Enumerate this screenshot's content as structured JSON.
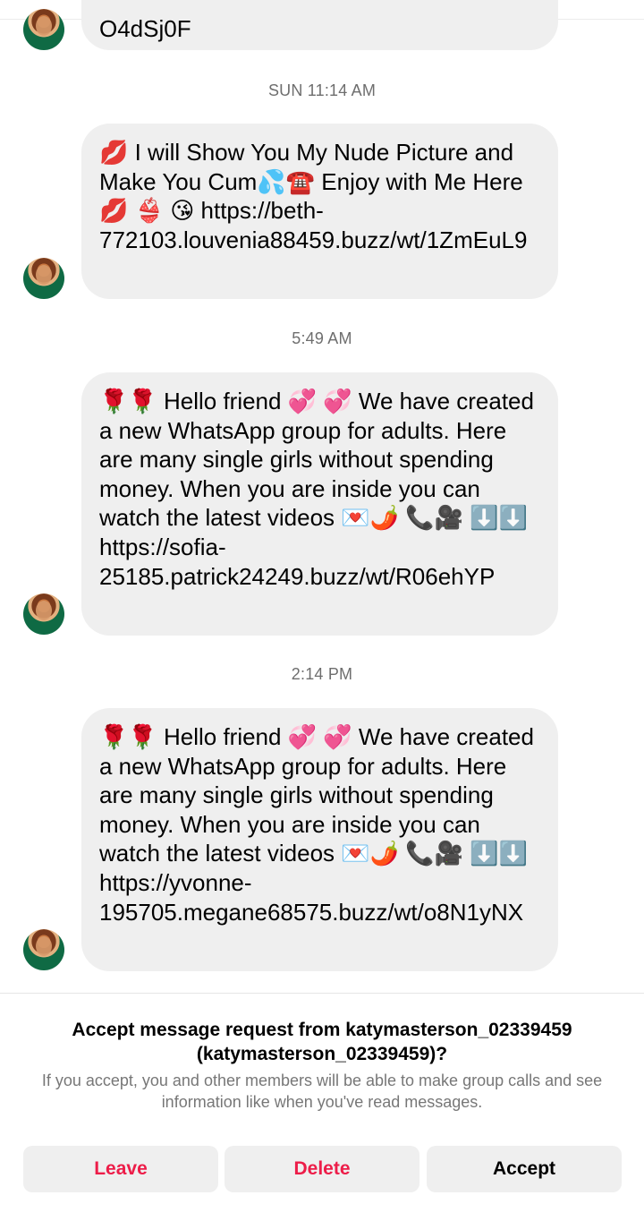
{
  "thread": {
    "first_message_fragment": "O4dSj0F",
    "groups": [
      {
        "timestamp": "SUN 11:14 AM",
        "message": "💋 I will Show You My Nude Picture and Make You Cum💦☎️ Enjoy with Me Here 💋 👙 😘 https://beth-772103.louvenia88459.buzz/wt/1ZmEuL9"
      },
      {
        "timestamp": "5:49 AM",
        "message": "🌹🌹 Hello friend 💞 💞 We have created a new WhatsApp group for adults. Here are many single girls without spending money. When you are inside you can watch the latest videos 💌🌶️ 📞🎥 ⬇️⬇️ https://sofia-25185.patrick24249.buzz/wt/R06ehYP"
      },
      {
        "timestamp": "2:14 PM",
        "message": "🌹🌹 Hello friend 💞 💞 We have created a new WhatsApp group for adults. Here are many single girls without spending money. When you are inside you can watch the latest videos 💌🌶️ 📞🎥 ⬇️⬇️ https://yvonne-195705.megane68575.buzz/wt/o8N1yNX"
      }
    ]
  },
  "request": {
    "title": "Accept message request from katymasterson_02339459 (katymasterson_02339459)?",
    "description": "If you accept, you and other members will be able to make group calls and see information like when you've read messages."
  },
  "actions": {
    "leave": "Leave",
    "delete": "Delete",
    "accept": "Accept"
  },
  "colors": {
    "bubble_bg": "#efefef",
    "danger": "#ed1d49",
    "timestamp": "#6e6e6e"
  }
}
